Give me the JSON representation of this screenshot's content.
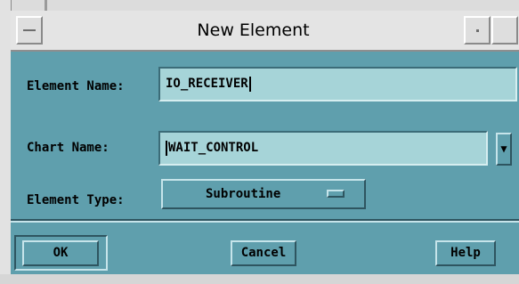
{
  "window": {
    "title": "New Element"
  },
  "form": {
    "element_name": {
      "label": "Element Name:",
      "value": "IO_RECEIVER"
    },
    "chart_name": {
      "label": "Chart Name:",
      "value": "WAIT_CONTROL",
      "dropdown_glyph": "▼"
    },
    "element_type": {
      "label": "Element Type:",
      "value": "Subroutine"
    }
  },
  "buttons": {
    "ok": "OK",
    "cancel": "Cancel",
    "help": "Help"
  },
  "colors": {
    "dialog_background": "#5f9fad",
    "field_background": "#a6d4d8",
    "titlebar": "#e4e4e4"
  },
  "icons": {
    "window_menu": "window-menu-icon",
    "minimize": "minimize-icon",
    "maximize": "maximize-icon",
    "chart_dropdown": "chevron-down-icon",
    "option_menu": "option-menu-indicator-icon"
  }
}
